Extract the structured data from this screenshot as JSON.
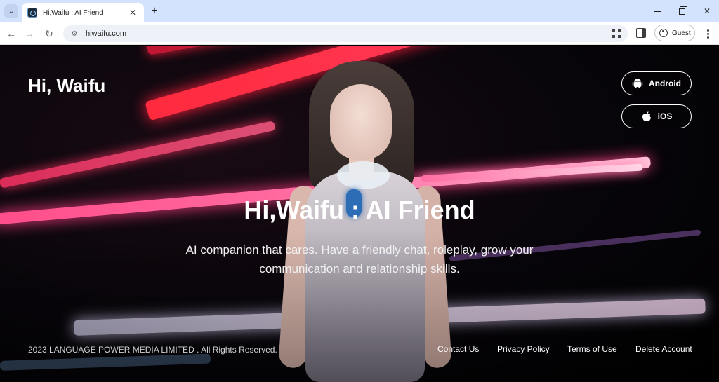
{
  "browser": {
    "tab_title": "Hi,Waifu : AI Friend",
    "tab_close": "✕",
    "new_tab": "+",
    "url": "hiwaifu.com",
    "profile_label": "Guest"
  },
  "page": {
    "logo": "Hi, Waifu",
    "store_buttons": [
      {
        "label": "Android",
        "icon": "android-icon"
      },
      {
        "label": "iOS",
        "icon": "apple-icon"
      }
    ],
    "hero_title": "Hi,Waifu : AI Friend",
    "hero_subtitle": "AI companion that cares. Have a friendly chat, roleplay, grow your communication and relationship skills.",
    "footer": {
      "copyright": "2023 LANGUAGE POWER MEDIA LIMITED . All Rights Reserved.",
      "links": [
        "Contact Us",
        "Privacy Policy",
        "Terms of Use",
        "Delete Account"
      ]
    }
  },
  "colors": {
    "tabbar": "#d3e3fd",
    "neon_red": "#ff2a3e",
    "neon_pink": "#ff4d8a"
  }
}
